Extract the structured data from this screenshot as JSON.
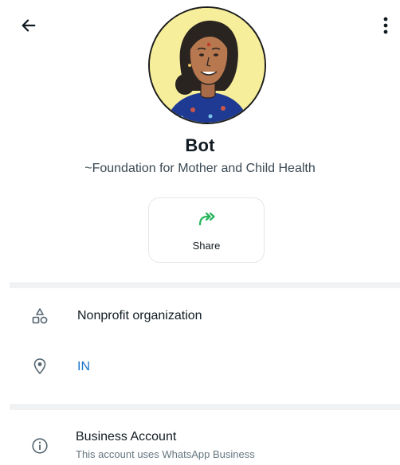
{
  "header": {
    "back_icon": "arrow-left-icon",
    "more_icon": "more-vertical-icon"
  },
  "profile": {
    "avatar": "profile-illustration-avatar",
    "name": "Bot",
    "tagline": "~Foundation for Mother and Child Health"
  },
  "actions": {
    "share_label": "Share",
    "share_icon": "share-forward-icon",
    "share_color": "#25b45a"
  },
  "details": {
    "category": {
      "icon": "category-shapes-icon",
      "text": "Nonprofit organization"
    },
    "location": {
      "icon": "location-pin-icon",
      "text": "IN",
      "color": "#1a73c8"
    }
  },
  "business": {
    "icon": "info-circle-icon",
    "title": "Business Account",
    "subtitle": "This account uses WhatsApp Business"
  }
}
